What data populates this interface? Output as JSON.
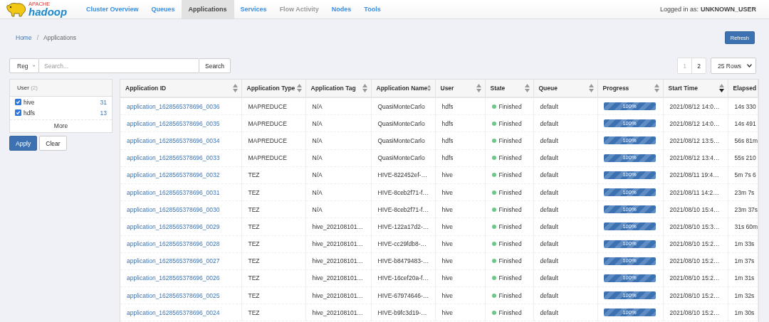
{
  "logo": {
    "top": "APACHE",
    "word": "hadoop"
  },
  "nav": [
    {
      "label": "Cluster Overview",
      "selected": false,
      "disabled": false
    },
    {
      "label": "Queues",
      "selected": false,
      "disabled": false
    },
    {
      "label": "Applications",
      "selected": true,
      "disabled": false
    },
    {
      "label": "Services",
      "selected": false,
      "disabled": false
    },
    {
      "label": "Flow Activity",
      "selected": false,
      "disabled": true
    },
    {
      "label": "Nodes",
      "selected": false,
      "disabled": false
    },
    {
      "label": "Tools",
      "selected": false,
      "disabled": false
    }
  ],
  "login": {
    "prefix": "Logged in as:",
    "user": "UNKNOWN_USER"
  },
  "breadcrumb": [
    {
      "label": "Home",
      "link": true
    },
    {
      "label": "Applications",
      "link": false
    }
  ],
  "breadcrumb_separator": "/",
  "refresh_button": "Refresh",
  "search": {
    "mode": "Reg",
    "placeholder": "Search...",
    "button": "Search"
  },
  "pagination": [
    {
      "label": "1",
      "selected": true
    },
    {
      "label": "2",
      "selected": false
    }
  ],
  "rows_select": "25 Rows",
  "facet": {
    "title": "User",
    "count": "(2)",
    "items": [
      {
        "label": "hive",
        "count": "31",
        "checked": true
      },
      {
        "label": "hdfs",
        "count": "13",
        "checked": true
      }
    ],
    "more": "More"
  },
  "facet_buttons": [
    {
      "label": "Apply",
      "kind": "primary"
    },
    {
      "label": "Clear",
      "kind": "default"
    }
  ],
  "table": {
    "columns": [
      {
        "label": "Application ID",
        "sorted": false
      },
      {
        "label": "Application Type",
        "sorted": false
      },
      {
        "label": "Application Tag",
        "sorted": false
      },
      {
        "label": "Application Name",
        "sorted": false
      },
      {
        "label": "User",
        "sorted": false
      },
      {
        "label": "State",
        "sorted": false
      },
      {
        "label": "Queue",
        "sorted": false
      },
      {
        "label": "Progress",
        "sorted": false
      },
      {
        "label": "Start Time",
        "sorted": true
      },
      {
        "label": "Elapsed"
      }
    ],
    "rows": [
      {
        "id": "application_1628565378696_0036",
        "type": "MAPREDUCE",
        "tag": "N/A",
        "name": "QuasiMonteCarlo",
        "user": "hdfs",
        "state": "Finished",
        "color": "#6cc788",
        "queue": "default",
        "level": 1,
        "progress": "100%",
        "start": "2021/08/12 14:0…",
        "elapsed": "14s 330"
      },
      {
        "id": "application_1628565378696_0035",
        "type": "MAPREDUCE",
        "tag": "N/A",
        "name": "QuasiMonteCarlo",
        "user": "hdfs",
        "state": "Finished",
        "color": "#6cc788",
        "queue": "default",
        "level": 1,
        "progress": "100%",
        "start": "2021/08/12 14:0…",
        "elapsed": "14s 491"
      },
      {
        "id": "application_1628565378696_0034",
        "type": "MAPREDUCE",
        "tag": "N/A",
        "name": "QuasiMonteCarlo",
        "user": "hdfs",
        "state": "Finished",
        "color": "#6cc788",
        "queue": "default",
        "level": 1,
        "progress": "100%",
        "start": "2021/08/12 13:5…",
        "elapsed": "56s 81m"
      },
      {
        "id": "application_1628565378696_0033",
        "type": "MAPREDUCE",
        "tag": "N/A",
        "name": "QuasiMonteCarlo",
        "user": "hdfs",
        "state": "Finished",
        "color": "#6cc788",
        "queue": "default",
        "level": 1,
        "progress": "100%",
        "start": "2021/08/12 13:4…",
        "elapsed": "55s 210"
      },
      {
        "id": "application_1628565378696_0032",
        "type": "TEZ",
        "tag": "N/A",
        "name": "HIVE-822452ef-…",
        "user": "hive",
        "state": "Finished",
        "color": "#6cc788",
        "queue": "default",
        "level": 1,
        "progress": "100%",
        "start": "2021/08/11 19:4…",
        "elapsed": "5m 7s 6"
      },
      {
        "id": "application_1628565378696_0031",
        "type": "TEZ",
        "tag": "N/A",
        "name": "HIVE-8ceb2f71-f…",
        "user": "hive",
        "state": "Finished",
        "color": "#6cc788",
        "queue": "default",
        "level": 1,
        "progress": "100%",
        "start": "2021/08/11 14:2…",
        "elapsed": "23m 7s"
      },
      {
        "id": "application_1628565378696_0030",
        "type": "TEZ",
        "tag": "N/A",
        "name": "HIVE-8ceb2f71-f…",
        "user": "hive",
        "state": "Finished",
        "color": "#6cc788",
        "queue": "default",
        "level": 1,
        "progress": "100%",
        "start": "2021/08/10 15:4…",
        "elapsed": "23m 37s"
      },
      {
        "id": "application_1628565378696_0029",
        "type": "TEZ",
        "tag": "hive_202108101…",
        "name": "HIVE-122a17d2-…",
        "user": "hive",
        "state": "Finished",
        "color": "#6cc788",
        "queue": "default",
        "level": 1,
        "progress": "100%",
        "start": "2021/08/10 15:3…",
        "elapsed": "31s 60m"
      },
      {
        "id": "application_1628565378696_0028",
        "type": "TEZ",
        "tag": "hive_202108101…",
        "name": "HIVE-cc29fdb8-…",
        "user": "hive",
        "state": "Finished",
        "color": "#6cc788",
        "queue": "default",
        "level": 1,
        "progress": "100%",
        "start": "2021/08/10 15:2…",
        "elapsed": "1m 33s"
      },
      {
        "id": "application_1628565378696_0027",
        "type": "TEZ",
        "tag": "hive_202108101…",
        "name": "HIVE-b8479483-…",
        "user": "hive",
        "state": "Finished",
        "color": "#6cc788",
        "queue": "default",
        "level": 1,
        "progress": "100%",
        "start": "2021/08/10 15:2…",
        "elapsed": "1m 37s"
      },
      {
        "id": "application_1628565378696_0026",
        "type": "TEZ",
        "tag": "hive_202108101…",
        "name": "HIVE-16cef20a-f…",
        "user": "hive",
        "state": "Finished",
        "color": "#6cc788",
        "queue": "default",
        "level": 1,
        "progress": "100%",
        "start": "2021/08/10 15:2…",
        "elapsed": "1m 31s"
      },
      {
        "id": "application_1628565378696_0025",
        "type": "TEZ",
        "tag": "hive_202108101…",
        "name": "HIVE-67974646-…",
        "user": "hive",
        "state": "Finished",
        "color": "#6cc788",
        "queue": "default",
        "level": 1,
        "progress": "100%",
        "start": "2021/08/10 15:2…",
        "elapsed": "1m 32s"
      },
      {
        "id": "application_1628565378696_0024",
        "type": "TEZ",
        "tag": "hive_202108101…",
        "name": "HIVE-b9fc3d19-…",
        "user": "hive",
        "state": "Finished",
        "color": "#6cc788",
        "queue": "default",
        "level": 1,
        "progress": "100%",
        "start": "2021/08/10 15:2…",
        "elapsed": "1m 30s"
      }
    ]
  }
}
